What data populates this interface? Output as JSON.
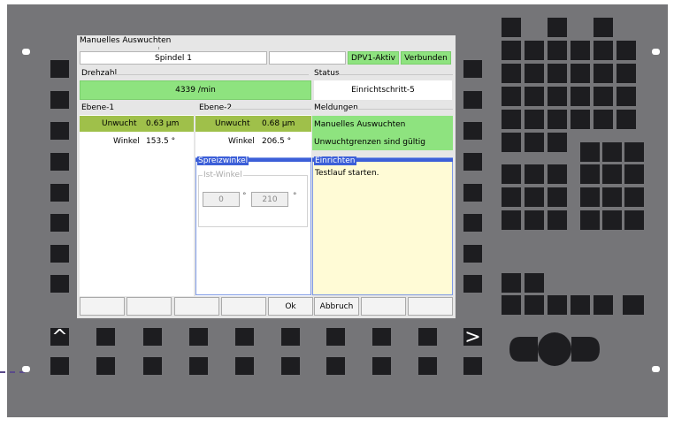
{
  "screen": {
    "title": "Manuelles Auswuchten",
    "spindle": "Spindel 1",
    "dpv_status": "DPV1-Aktiv",
    "connection": "Verbunden",
    "drehzahl_label": "Drehzahl",
    "drehzahl_value": "4339 /min",
    "status_label": "Status",
    "status_value": "Einrichtschritt-5",
    "ebene1": {
      "label": "Ebene-1",
      "unwucht_label": "Unwucht",
      "unwucht_value": "0.63 µm",
      "winkel_label": "Winkel",
      "winkel_value": "153.5 °"
    },
    "ebene2": {
      "label": "Ebene-2",
      "unwucht_label": "Unwucht",
      "unwucht_value": "0.68 µm",
      "winkel_label": "Winkel",
      "winkel_value": "206.5 °"
    },
    "meldungen_label": "Meldungen",
    "meldungen": [
      "Manuelles Auswuchten",
      "Unwuchtgrenzen sind gültig"
    ],
    "spreizwinkel_label": "Spreizwinkel",
    "ist_winkel_label": "Ist-Winkel",
    "ist_winkel_from": "0",
    "ist_winkel_to": "210",
    "degree": "°",
    "einrichten_label": "Einrichten",
    "einrichten_text": "Testlauf starten.",
    "buttons": [
      "",
      "",
      "",
      "",
      "Ok",
      "Abbruch",
      "",
      ""
    ]
  },
  "keys": {
    "up_arrow": "^",
    "right_arrow": ">"
  },
  "colors": {
    "bezel": "#757578",
    "key": "#1d1d20",
    "green": "#8ee37f",
    "olive": "#9fc04a",
    "yellow_panel": "#fffbd6",
    "blue": "#3c5fd8"
  }
}
